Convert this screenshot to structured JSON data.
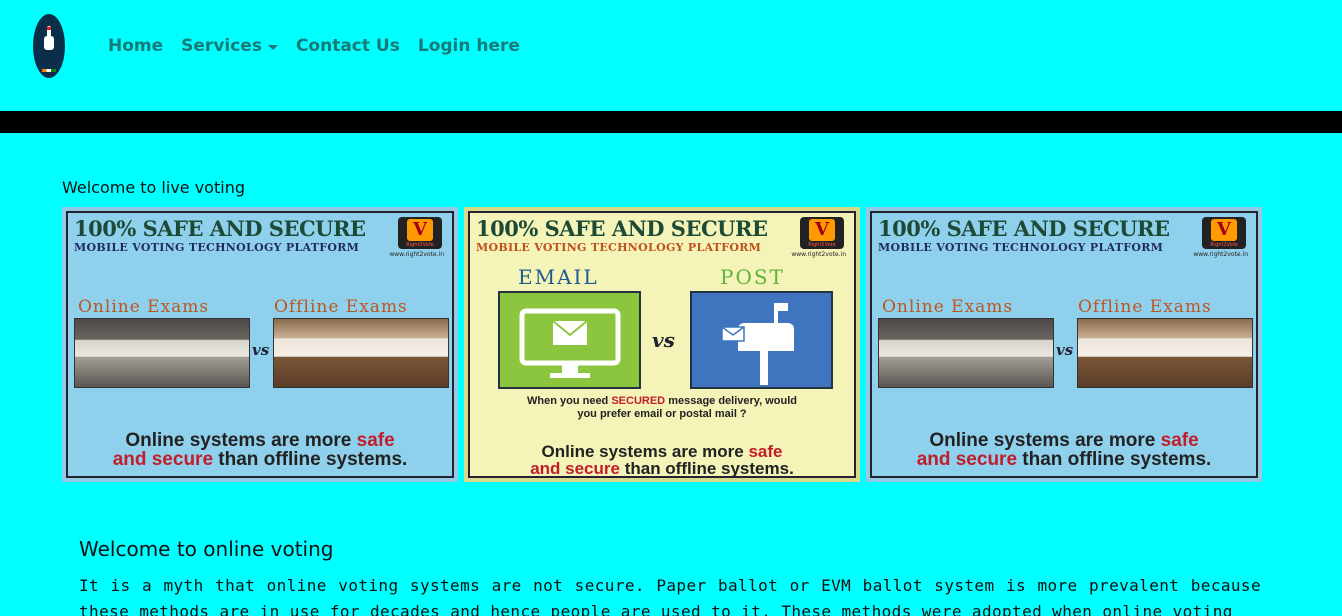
{
  "nav": {
    "items": [
      {
        "label": "Home"
      },
      {
        "label": "Services",
        "has_dropdown": true
      },
      {
        "label": "Contact Us"
      },
      {
        "label": "Login here"
      }
    ]
  },
  "hero": {
    "heading": "Welcome to live voting"
  },
  "banners": [
    {
      "title": "100% SAFE AND SECURE",
      "subtitle": "MOBILE VOTING TECHNOLOGY PLATFORM",
      "badge_letter": "V",
      "badge_text": "Right2Vote",
      "url": "www.right2vote.in",
      "left_label": "Online Exams",
      "right_label": "Offline Exams",
      "vs": "vs",
      "footer_1": "Online systems are more ",
      "footer_red_1": "safe",
      "footer_red_2": "and secure",
      "footer_2": " than offline systems."
    },
    {
      "title": "100% SAFE AND SECURE",
      "subtitle": "MOBILE VOTING TECHNOLOGY PLATFORM",
      "badge_letter": "V",
      "badge_text": "Right2Vote",
      "url": "www.right2vote.in",
      "left_label": "EMAIL",
      "right_label": "POST",
      "vs": "vs",
      "question_1": "When you need ",
      "question_red": "SECURED",
      "question_2": " message delivery, would",
      "question_3": "you prefer email or postal mail ?",
      "footer_1": "Online systems are more ",
      "footer_red_1": "safe",
      "footer_red_2": "and secure",
      "footer_2": " than offline systems."
    },
    {
      "title": "100% SAFE AND SECURE",
      "subtitle": "MOBILE VOTING TECHNOLOGY PLATFORM",
      "badge_letter": "V",
      "badge_text": "Right2Vote",
      "url": "www.right2vote.in",
      "left_label": "Online Exams",
      "right_label": "Offline Exams",
      "vs": "vs",
      "footer_1": "Online systems are more ",
      "footer_red_1": "safe",
      "footer_red_2": "and secure",
      "footer_2": " than offline systems."
    }
  ],
  "section": {
    "heading": "Welcome to online voting",
    "body": "It is a myth that online voting systems are not secure. Paper ballot or EVM ballot system is more prevalent because these methods are in use for decades and hence people are used to it. These methods were adopted when online voting"
  },
  "colors": {
    "page_bg": "#00ffff",
    "nav_link": "#177a78",
    "bar": "#000000",
    "accent_red": "#c21d2b"
  }
}
